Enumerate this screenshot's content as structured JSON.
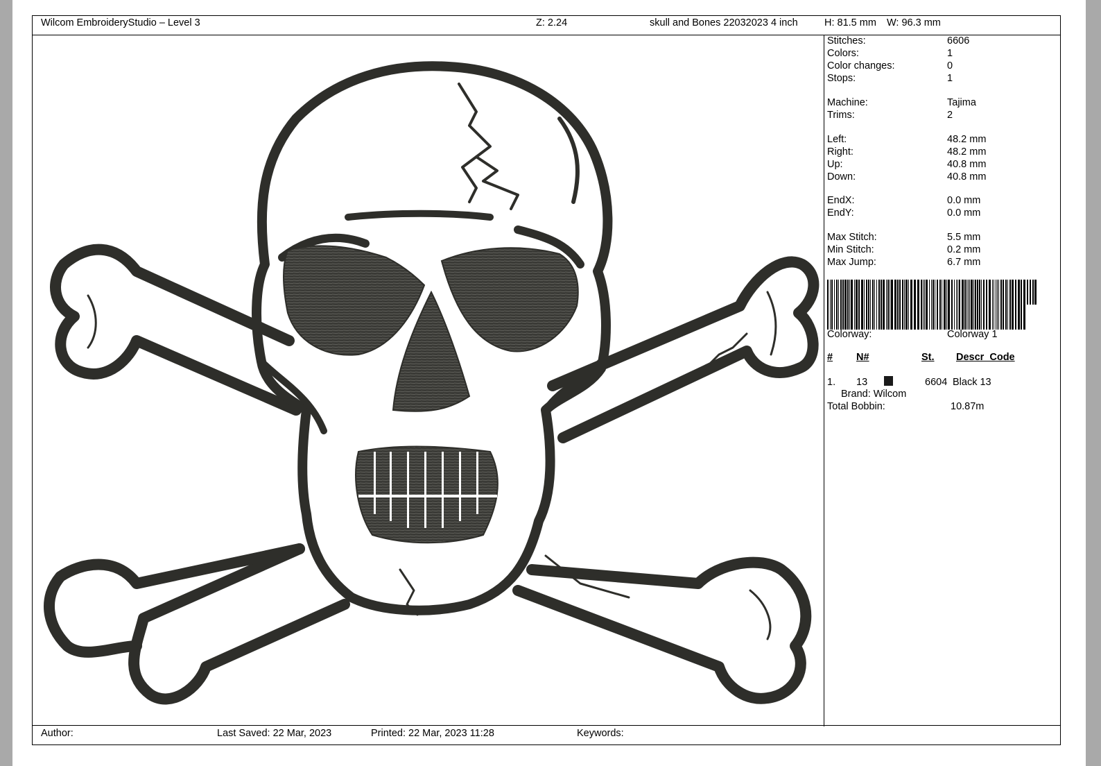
{
  "header": {
    "app": "Wilcom EmbroideryStudio – Level 3",
    "zoom": "Z: 2.24",
    "design_name": "skull and Bones 22032023 4 inch",
    "height": "H: 81.5 mm",
    "width": "W: 96.3 mm"
  },
  "stats": {
    "stitches_label": "Stitches:",
    "stitches": "6606",
    "colors_label": "Colors:",
    "colors": "1",
    "color_changes_label": "Color changes:",
    "color_changes": "0",
    "stops_label": "Stops:",
    "stops": "1",
    "machine_label": "Machine:",
    "machine": "Tajima",
    "trims_label": "Trims:",
    "trims": "2",
    "left_label": "Left:",
    "left": "48.2 mm",
    "right_label": "Right:",
    "right": "48.2 mm",
    "up_label": "Up:",
    "up": "40.8 mm",
    "down_label": "Down:",
    "down": "40.8 mm",
    "endx_label": "EndX:",
    "endx": "0.0 mm",
    "endy_label": "EndY:",
    "endy": "0.0 mm",
    "max_stitch_label": "Max Stitch:",
    "max_stitch": "5.5 mm",
    "min_stitch_label": "Min Stitch:",
    "min_stitch": "0.2 mm",
    "max_jump_label": "Max Jump:",
    "max_jump": "6.7 mm",
    "colorway_label": "Colorway:",
    "colorway": "Colorway 1"
  },
  "color_table": {
    "headers": [
      "#",
      "N#",
      "St.",
      "Descr_Code"
    ],
    "rows": [
      {
        "index": "1.",
        "number": "13",
        "stitches": "6604",
        "descr": "Black 13",
        "swatch_color": "#1a1a1a",
        "brand": "Brand: Wilcom"
      }
    ],
    "total_bobbin_label": "Total Bobbin:",
    "total_bobbin": "10.87m"
  },
  "footer": {
    "author": "Author:",
    "last_saved": "Last Saved: 22 Mar, 2023",
    "printed": "Printed: 22 Mar, 2023 11:28",
    "keywords": "Keywords:"
  },
  "colors": {
    "thread": "#2e2e2a",
    "page": "#ffffff",
    "background": "#a9a9a9"
  }
}
